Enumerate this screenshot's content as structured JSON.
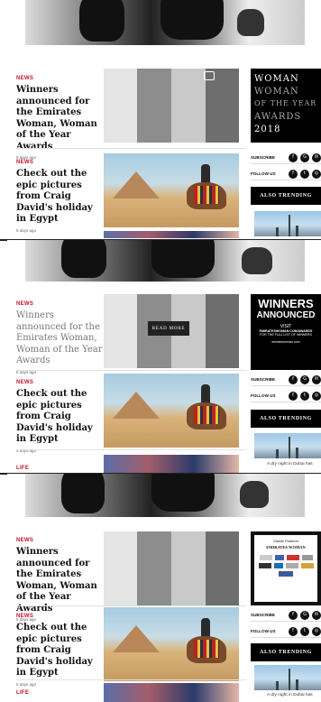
{
  "articles": [
    {
      "category": "NEWS",
      "title": "Winners announced for the Emirates Woman, Woman of the Year Awards",
      "ago": "5 days ago"
    },
    {
      "category": "NEWS",
      "title": "Check out the epic pictures from Craig David's holiday in Egypt",
      "ago": "5 days ago"
    },
    {
      "category": "LIFE"
    }
  ],
  "read_more": "READ MORE",
  "ads": {
    "ad1": {
      "line1": "WOMAN",
      "line2": "WOMAN",
      "line3": "OF THE YEAR",
      "line4": "AWARDS",
      "line5": "2018"
    },
    "ad2": {
      "line1": "WINNERS",
      "line2": "ANNOUNCED",
      "line3": "VISIT",
      "line4": "EMIRATESWOMAN.COM/AWARDS",
      "line5": "FOR THE FULL LIST OF WINNERS",
      "line6": "emiratewoman.com"
    },
    "ad3": {
      "line1": "Visible Partners",
      "line2": "EMIRATES WOMAN"
    }
  },
  "sidebar": {
    "subscribe": "SUBSCRIBE",
    "follow_us": "FOLLOW US",
    "also_trending": "ALSO TRENDING",
    "trend_caption": "A dry night in Dubai has"
  },
  "icons": {
    "subscribe": [
      "facebook-icon",
      "google-plus-icon",
      "email-icon"
    ],
    "follow": [
      "facebook-icon",
      "twitter-icon",
      "instagram-icon"
    ]
  }
}
